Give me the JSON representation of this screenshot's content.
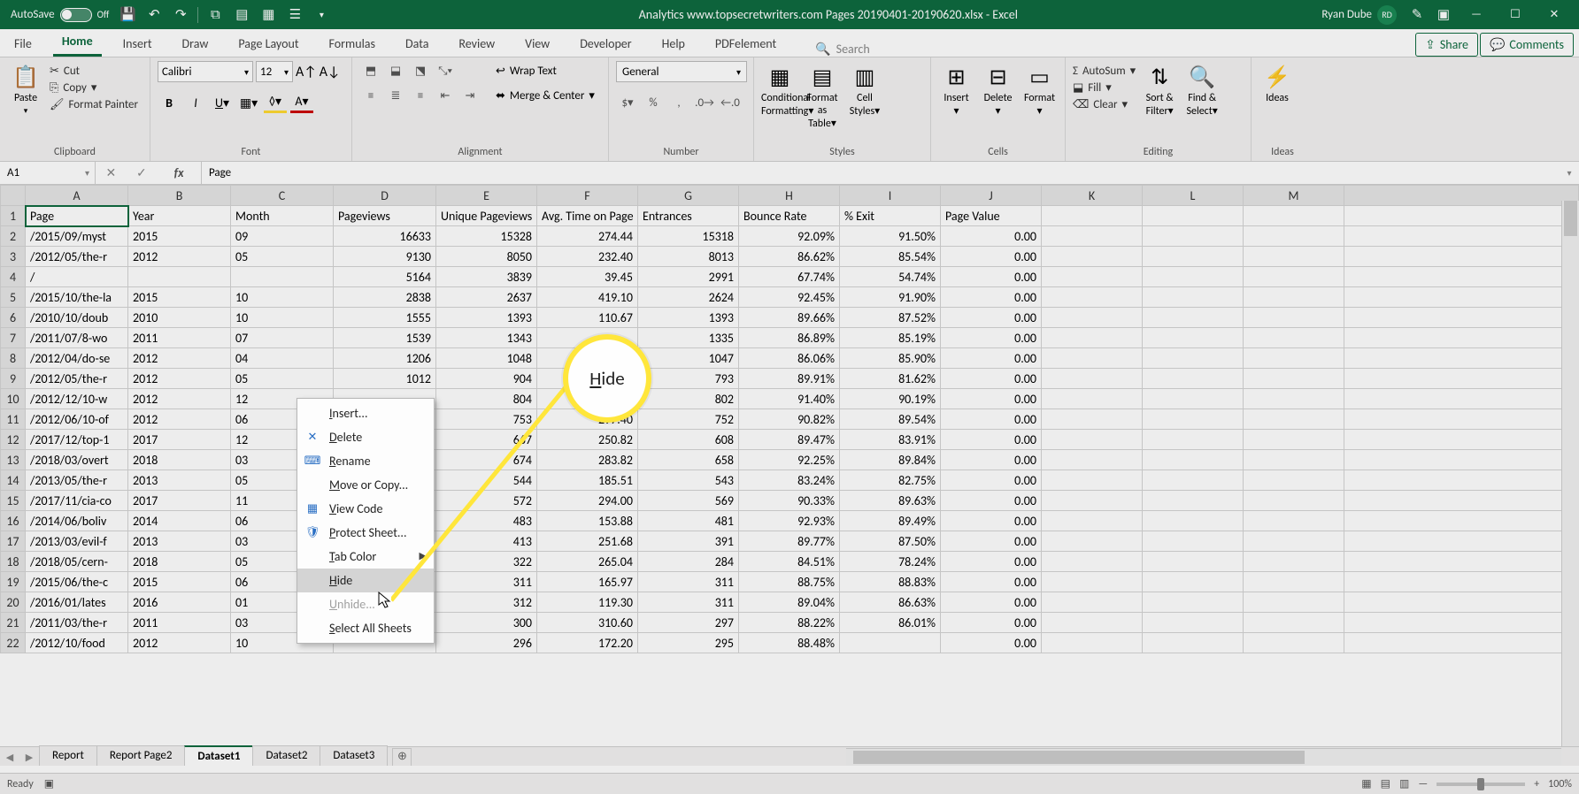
{
  "titlebar": {
    "autosave_label": "AutoSave",
    "autosave_state": "Off",
    "doc_title": "Analytics www.topsecretwriters.com Pages 20190401-20190620.xlsx - Excel",
    "user_name": "Ryan Dube",
    "user_initials": "RD"
  },
  "menu": {
    "tabs": [
      "File",
      "Home",
      "Insert",
      "Draw",
      "Page Layout",
      "Formulas",
      "Data",
      "Review",
      "View",
      "Developer",
      "Help",
      "PDFelement"
    ],
    "active": "Home",
    "search_placeholder": "Search",
    "share": "Share",
    "comments": "Comments"
  },
  "ribbon": {
    "clipboard": {
      "paste": "Paste",
      "cut": "Cut",
      "copy": "Copy",
      "format_painter": "Format Painter",
      "label": "Clipboard"
    },
    "font": {
      "name": "Calibri",
      "size": "12",
      "label": "Font"
    },
    "alignment": {
      "wrap": "Wrap Text",
      "merge": "Merge & Center",
      "label": "Alignment"
    },
    "number": {
      "format": "General",
      "label": "Number"
    },
    "styles": {
      "cond": "Conditional\nFormatting",
      "fas": "Format as\nTable",
      "cell": "Cell\nStyles",
      "label": "Styles"
    },
    "cells": {
      "insert": "Insert",
      "delete": "Delete",
      "format": "Format",
      "label": "Cells"
    },
    "editing": {
      "autosum": "AutoSum",
      "fill": "Fill",
      "clear": "Clear",
      "sort": "Sort &\nFilter",
      "find": "Find &\nSelect",
      "label": "Editing"
    },
    "ideas": {
      "ideas": "Ideas",
      "label": "Ideas"
    }
  },
  "formula_bar": {
    "name_box": "A1",
    "value": "Page"
  },
  "grid": {
    "col_letters": [
      "A",
      "B",
      "C",
      "D",
      "E",
      "F",
      "G",
      "H",
      "I",
      "J",
      "K",
      "L",
      "M"
    ],
    "headers": [
      "Page",
      "Year",
      "Month",
      "Pageviews",
      "Unique Pageviews",
      "Avg. Time on Page",
      "Entrances",
      "Bounce Rate",
      "% Exit",
      "Page Value"
    ],
    "rows": [
      [
        "/2015/09/myst",
        "2015",
        "09",
        "16633",
        "15328",
        "274.44",
        "15318",
        "92.09%",
        "91.50%",
        "0.00"
      ],
      [
        "/2012/05/the-r",
        "2012",
        "05",
        "9130",
        "8050",
        "232.40",
        "8013",
        "86.62%",
        "85.54%",
        "0.00"
      ],
      [
        "/",
        "",
        "",
        "5164",
        "3839",
        "39.45",
        "2991",
        "67.74%",
        "54.74%",
        "0.00"
      ],
      [
        "/2015/10/the-la",
        "2015",
        "10",
        "2838",
        "2637",
        "419.10",
        "2624",
        "92.45%",
        "91.90%",
        "0.00"
      ],
      [
        "/2010/10/doub",
        "2010",
        "10",
        "1555",
        "1393",
        "110.67",
        "1393",
        "89.66%",
        "87.52%",
        "0.00"
      ],
      [
        "/2011/07/8-wo",
        "2011",
        "07",
        "1539",
        "1343",
        "",
        "1335",
        "86.89%",
        "85.19%",
        "0.00"
      ],
      [
        "/2012/04/do-se",
        "2012",
        "04",
        "1206",
        "1048",
        "",
        "1047",
        "86.06%",
        "85.90%",
        "0.00"
      ],
      [
        "/2012/05/the-r",
        "2012",
        "05",
        "1012",
        "904",
        "",
        "793",
        "89.91%",
        "81.62%",
        "0.00"
      ],
      [
        "/2012/12/10-w",
        "2012",
        "12",
        "",
        "804",
        "",
        "802",
        "91.40%",
        "90.19%",
        "0.00"
      ],
      [
        "/2012/06/10-of",
        "2012",
        "06",
        "",
        "753",
        "297.40",
        "752",
        "90.82%",
        "89.54%",
        "0.00"
      ],
      [
        "/2017/12/top-1",
        "2017",
        "12",
        "",
        "667",
        "250.82",
        "608",
        "89.47%",
        "83.91%",
        "0.00"
      ],
      [
        "/2018/03/overt",
        "2018",
        "03",
        "",
        "674",
        "283.82",
        "658",
        "92.25%",
        "89.84%",
        "0.00"
      ],
      [
        "/2013/05/the-r",
        "2013",
        "05",
        "",
        "544",
        "185.51",
        "543",
        "83.24%",
        "82.75%",
        "0.00"
      ],
      [
        "/2017/11/cia-co",
        "2017",
        "11",
        "",
        "572",
        "294.00",
        "569",
        "90.33%",
        "89.63%",
        "0.00"
      ],
      [
        "/2014/06/boliv",
        "2014",
        "06",
        "",
        "483",
        "153.88",
        "481",
        "92.93%",
        "89.49%",
        "0.00"
      ],
      [
        "/2013/03/evil-f",
        "2013",
        "03",
        "",
        "413",
        "251.68",
        "391",
        "89.77%",
        "87.50%",
        "0.00"
      ],
      [
        "/2018/05/cern-",
        "2018",
        "05",
        "",
        "322",
        "265.04",
        "284",
        "84.51%",
        "78.24%",
        "0.00"
      ],
      [
        "/2015/06/the-c",
        "2015",
        "06",
        "",
        "311",
        "165.97",
        "311",
        "88.75%",
        "88.83%",
        "0.00"
      ],
      [
        "/2016/01/lates",
        "2016",
        "01",
        "",
        "312",
        "119.30",
        "311",
        "89.04%",
        "86.63%",
        "0.00"
      ],
      [
        "/2011/03/the-r",
        "2011",
        "03",
        "",
        "300",
        "310.60",
        "297",
        "88.22%",
        "86.01%",
        "0.00"
      ],
      [
        "/2012/10/food",
        "2012",
        "10",
        "",
        "296",
        "172.20",
        "295",
        "88.48%",
        "",
        "0.00"
      ]
    ]
  },
  "sheets": {
    "tabs": [
      "Report",
      "Report Page2",
      "Dataset1",
      "Dataset2",
      "Dataset3"
    ],
    "active": "Dataset1"
  },
  "context_menu": {
    "items": [
      {
        "label": "Insert...",
        "icon": ""
      },
      {
        "label": "Delete",
        "icon": "✕"
      },
      {
        "label": "Rename",
        "icon": "⌨"
      },
      {
        "label": "Move or Copy...",
        "icon": ""
      },
      {
        "label": "View Code",
        "icon": "▦"
      },
      {
        "label": "Protect Sheet...",
        "icon": "🛡"
      },
      {
        "label": "Tab Color",
        "icon": "",
        "submenu": true
      },
      {
        "label": "Hide",
        "icon": "",
        "hover": true
      },
      {
        "label": "Unhide...",
        "icon": "",
        "disabled": true
      },
      {
        "label": "Select All Sheets",
        "icon": ""
      }
    ]
  },
  "callout": {
    "text": "Hide"
  },
  "statusbar": {
    "status": "Ready",
    "zoom": "100%"
  }
}
